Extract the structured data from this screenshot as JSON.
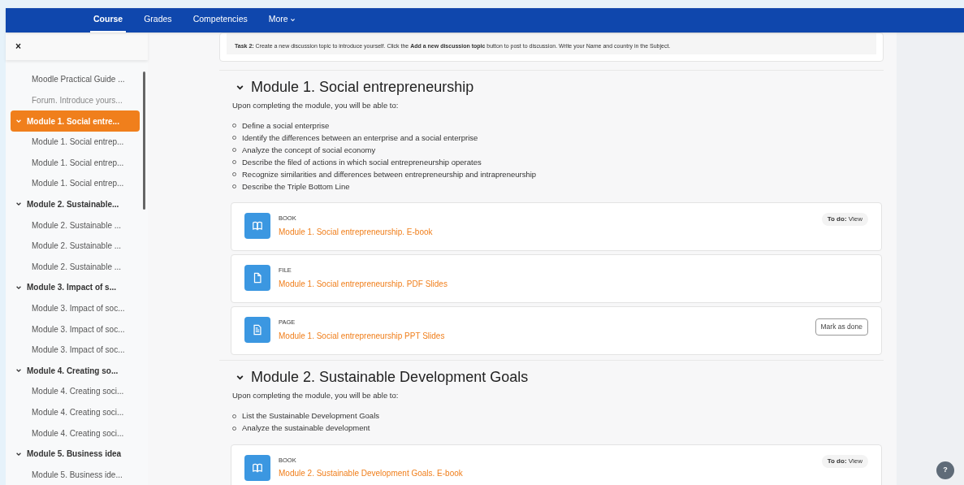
{
  "nav": {
    "tabs": [
      {
        "label": "Course",
        "selected": true,
        "kind": "link"
      },
      {
        "label": "Grades",
        "selected": false,
        "kind": "link"
      },
      {
        "label": "Competencies",
        "selected": false,
        "kind": "link"
      },
      {
        "label": "More",
        "selected": false,
        "kind": "menu"
      }
    ]
  },
  "sidebar": {
    "close": "×",
    "items": [
      {
        "kind": "activity",
        "label": "Moodle Practical Guide ...",
        "selected": false,
        "dimmed": false
      },
      {
        "kind": "activity",
        "label": "Forum. Introduce yours...",
        "selected": false,
        "dimmed": true
      },
      {
        "kind": "section",
        "label": "Module 1. Social entre...",
        "selected": true,
        "expanded": true,
        "children": [
          {
            "kind": "activity",
            "label": "Module 1. Social entrep...",
            "selected": false,
            "dimmed": false
          },
          {
            "kind": "activity",
            "label": "Module 1. Social entrep...",
            "selected": false,
            "dimmed": false
          },
          {
            "kind": "activity",
            "label": "Module 1. Social entrep...",
            "selected": false,
            "dimmed": false
          }
        ]
      },
      {
        "kind": "section",
        "label": "Module 2. Sustainable...",
        "selected": false,
        "expanded": true,
        "children": [
          {
            "kind": "activity",
            "label": "Module 2. Sustainable ...",
            "selected": false,
            "dimmed": false
          },
          {
            "kind": "activity",
            "label": "Module 2. Sustainable ...",
            "selected": false,
            "dimmed": false
          },
          {
            "kind": "activity",
            "label": "Module 2. Sustainable ...",
            "selected": false,
            "dimmed": false
          }
        ]
      },
      {
        "kind": "section",
        "label": "Module 3. Impact of s...",
        "selected": false,
        "expanded": true,
        "children": [
          {
            "kind": "activity",
            "label": "Module 3. Impact of soc...",
            "selected": false,
            "dimmed": false
          },
          {
            "kind": "activity",
            "label": "Module 3. Impact of soc...",
            "selected": false,
            "dimmed": false
          },
          {
            "kind": "activity",
            "label": "Module 3. Impact of soc...",
            "selected": false,
            "dimmed": false
          }
        ]
      },
      {
        "kind": "section",
        "label": "Module 4. Creating so...",
        "selected": false,
        "expanded": true,
        "children": [
          {
            "kind": "activity",
            "label": "Module 4. Creating soci...",
            "selected": false,
            "dimmed": false
          },
          {
            "kind": "activity",
            "label": "Module 4. Creating soci...",
            "selected": false,
            "dimmed": false
          },
          {
            "kind": "activity",
            "label": "Module 4. Creating soci...",
            "selected": false,
            "dimmed": false
          }
        ]
      },
      {
        "kind": "section",
        "label": "Module 5. Business idea",
        "selected": false,
        "expanded": true,
        "children": [
          {
            "kind": "activity",
            "label": "Module 5. Business ide...",
            "selected": false,
            "dimmed": false
          }
        ]
      }
    ]
  },
  "task_note": "**Task 2:** Create a new discussion topic to introduce yourself. Click the **Add a new discussion topic** button to post to discussion. Write your Name and country in the Subject.",
  "sections": [
    {
      "title": "Module 1. Social entrepreneurship",
      "expanded": true,
      "intro": "Upon completing the module, you will be able to:",
      "outcomes": [
        "Define a social enterprise",
        "Identify the differences between an enterprise and a social enterprise",
        "Analyze the concept of social economy",
        "Describe the filed of actions in which social entrepreneurship operates",
        "Recognize similarities and differences between entrepreneurship and intrapreneurship",
        "Describe the Triple Bottom Line"
      ],
      "activities": [
        {
          "kind": "book",
          "type_label": "BOOK",
          "title": "Module 1. Social entrepreneurship. E-book",
          "completion": {
            "kind": "todo",
            "label": "To do:",
            "value": "View"
          }
        },
        {
          "kind": "file",
          "type_label": "FILE",
          "title": "Module 1. Social entrepreneurship. PDF Slides"
        },
        {
          "kind": "page",
          "type_label": "PAGE",
          "title": "Module 1. Social entrepreneurship PPT Slides",
          "completion": {
            "kind": "button",
            "label": "Mark as done"
          }
        }
      ]
    },
    {
      "title": "Module 2. Sustainable Development Goals",
      "expanded": true,
      "intro": "Upon completing the module, you will be able to:",
      "outcomes": [
        "List the Sustainable Development Goals",
        "Analyze the sustainable development"
      ],
      "activities": [
        {
          "kind": "book",
          "type_label": "BOOK",
          "title": "Module 2. Sustainable Development Goals. E-book",
          "completion": {
            "kind": "todo",
            "label": "To do:",
            "value": "View"
          }
        }
      ]
    }
  ],
  "help_button": "?"
}
